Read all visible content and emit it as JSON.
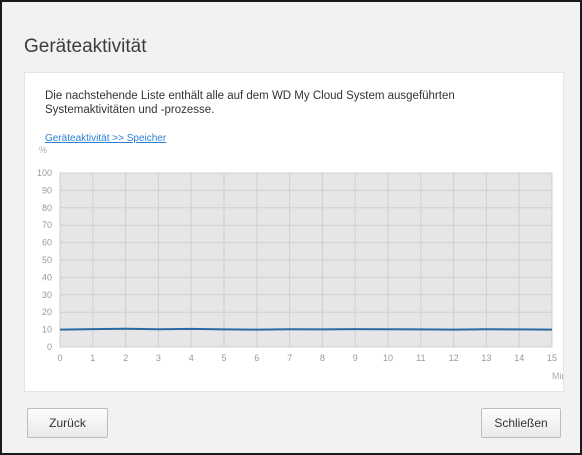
{
  "dialog": {
    "title": "Geräteaktivität",
    "description": "Die nachstehende Liste enthält alle auf dem WD My Cloud System ausgeführten Systemaktivitäten und -prozesse.",
    "breadcrumb_link": "Geräteaktivität >> Speicher",
    "back_button": "Zurück",
    "close_button": "Schließen"
  },
  "chart_data": {
    "type": "line",
    "y_unit_label": "%",
    "x_unit_label": "Mins",
    "ylim": [
      0,
      100
    ],
    "y_ticks": [
      0,
      10,
      20,
      30,
      40,
      50,
      60,
      70,
      80,
      90,
      100
    ],
    "x_ticks": [
      0,
      1,
      2,
      3,
      4,
      5,
      6,
      7,
      8,
      9,
      10,
      11,
      12,
      13,
      14,
      15
    ],
    "grid": true,
    "line_color": "#2a6aa3",
    "series": [
      {
        "x": [
          0,
          1,
          2,
          3,
          4,
          5,
          6,
          7,
          8,
          9,
          10,
          11,
          12,
          13,
          14,
          15
        ],
        "values": [
          10,
          10.3,
          10.5,
          10.2,
          10.4,
          10.1,
          10,
          10.2,
          10.1,
          10.3,
          10.2,
          10.1,
          10,
          10.2,
          10.1,
          10
        ]
      }
    ]
  }
}
